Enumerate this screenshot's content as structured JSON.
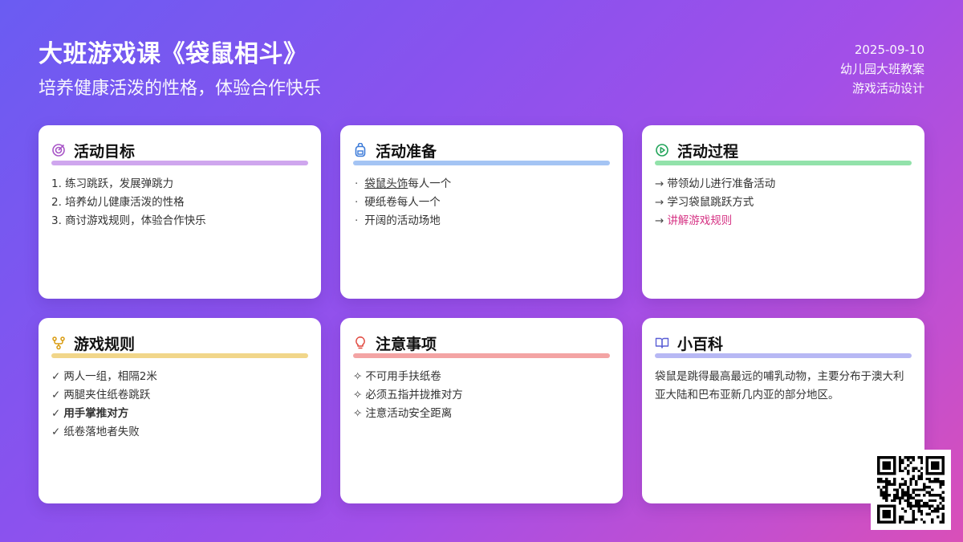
{
  "header": {
    "title": "大班游戏课《袋鼠相斗》",
    "subtitle": "培养健康活泼的性格，体验合作快乐",
    "date": "2025-09-10",
    "meta_line1": "幼儿园大班教案",
    "meta_line2": "游戏活动设计"
  },
  "colors": {
    "goals": "#cfa6ee",
    "prep": "#a4c4f4",
    "process": "#92e2aa",
    "rules": "#f1d68a",
    "notes": "#f3a4a4",
    "encyclopedia": "#b7b8f4",
    "highlight": "#d63384"
  },
  "cards": {
    "goals": {
      "title": "活动目标",
      "icon": "target-icon",
      "items": [
        "1. 练习跳跃，发展弹跳力",
        "2. 培养幼儿健康活泼的性格",
        "3. 商讨游戏规则，体验合作快乐"
      ]
    },
    "prep": {
      "title": "活动准备",
      "icon": "backpack-icon",
      "bullet": "·",
      "items": [
        "袋鼠头饰每人一个",
        "硬纸卷每人一个",
        "开阔的活动场地"
      ],
      "underlined": "袋鼠头饰",
      "item0_rest": "每人一个"
    },
    "process": {
      "title": "活动过程",
      "icon": "play-circle-icon",
      "arrow": "→",
      "items": [
        "带领幼儿进行准备活动",
        "学习袋鼠跳跃方式",
        "讲解游戏规则"
      ]
    },
    "rules": {
      "title": "游戏规则",
      "icon": "branch-icon",
      "check": "✓",
      "items": [
        "两人一组，相隔2米",
        "两腿夹住纸卷跳跃",
        "用手掌推对方",
        "纸卷落地者失败"
      ]
    },
    "notes": {
      "title": "注意事项",
      "icon": "lightbulb-icon",
      "mark": "✧",
      "items": [
        "不可用手扶纸卷",
        "必须五指并拢推对方",
        "注意活动安全距离"
      ]
    },
    "encyclopedia": {
      "title": "小百科",
      "icon": "book-icon",
      "text": "袋鼠是跳得最高最远的哺乳动物，主要分布于澳大利亚大陆和巴布亚新几内亚的部分地区。"
    }
  }
}
